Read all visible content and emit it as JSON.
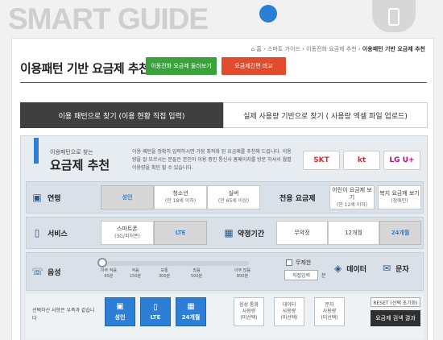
{
  "header": {
    "brand": "SMART GUIDE",
    "breadcrumb": [
      "홈",
      "스마트 가이드",
      "이동전화 요금제 추천",
      "이용패턴 기반 요금제 추천"
    ]
  },
  "page": {
    "title": "이용패턴 기반 요금제 추천",
    "browse_button": "이동전화 요금제 둘러보기",
    "compare_button": "요금제간편 비교"
  },
  "tabs": [
    {
      "label": "이용 패턴으로 찾기 (이용 현황 직접 입력)",
      "active": true
    },
    {
      "label": "실제 사용량 기반으로 찾기 ( 사용량 엑셀 파일 업로드)",
      "active": false
    }
  ],
  "intro": {
    "subtitle": "이용패턴으로 찾는",
    "title": "요금제 추천",
    "description": "이용 패턴을 정확히 입력하시면 가장 최적화 된 요금제를 추천해 드립니다. 이용량을 잘 모르시는 분들은 본인이 이용 중인 통신사 홈페이지를 방문 하셔서 월별 이용량을 확인 할 수 있습니다."
  },
  "carriers": [
    {
      "name": "SKT",
      "color": "#e5262b"
    },
    {
      "name": "kt",
      "color": "#d9262e"
    },
    {
      "name": "LG U+",
      "color": "#c4007a"
    }
  ],
  "age": {
    "label": "연령",
    "options": [
      {
        "label": "성인",
        "sub": "",
        "selected": true
      },
      {
        "label": "청소년",
        "sub": "(만 18세 이하)",
        "selected": false
      },
      {
        "label": "실버",
        "sub": "(만 65세 이상)",
        "selected": false
      }
    ]
  },
  "exclusive": {
    "label": "전용 요금제",
    "options": [
      {
        "label": "어린이 요금제 보기",
        "sub": "(만 12세 이하)"
      },
      {
        "label": "복지 요금제 보기",
        "sub": "(장애인)"
      }
    ]
  },
  "service": {
    "label": "서비스",
    "options": [
      {
        "label": "스마트폰",
        "sub": "(3G/피처폰)",
        "selected": false
      },
      {
        "label": "LTE",
        "sub": "",
        "selected": true
      }
    ]
  },
  "contract": {
    "label": "약정기간",
    "options": [
      {
        "label": "무약정",
        "selected": false
      },
      {
        "label": "12개월",
        "selected": false
      },
      {
        "label": "24개월",
        "selected": true
      }
    ]
  },
  "voice": {
    "label": "음성",
    "slider_level": 0,
    "ticks": [
      {
        "top": "아주 적음",
        "bot": "65분"
      },
      {
        "top": "적음",
        "bot": "150분"
      },
      {
        "top": "보통",
        "bot": "300분"
      },
      {
        "top": "많음",
        "bot": "500분"
      },
      {
        "top": "아주 많음",
        "bot": "800분"
      }
    ],
    "unlimited": "무제한",
    "direct_input": "직접입력",
    "unit": "분"
  },
  "data_label": "데이터",
  "sms_label": "문자",
  "bottom": {
    "notice": "선택하신 사항은 우측과 같습니다",
    "chips": [
      {
        "label": "성인",
        "icon": "person"
      },
      {
        "label": "LTE",
        "icon": "phone"
      },
      {
        "label": "24개월",
        "icon": "calendar"
      }
    ],
    "pending": [
      {
        "line1": "음성 통화",
        "line2": "사용량",
        "line3": "(미선택)"
      },
      {
        "line1": "데이터",
        "line2": "사용량",
        "line3": "(미선택)"
      },
      {
        "line1": "문자",
        "line2": "사용량",
        "line3": "(미선택)"
      }
    ],
    "reset": "RESET (선택 초기화)",
    "result": "요금제 검색 결과"
  }
}
